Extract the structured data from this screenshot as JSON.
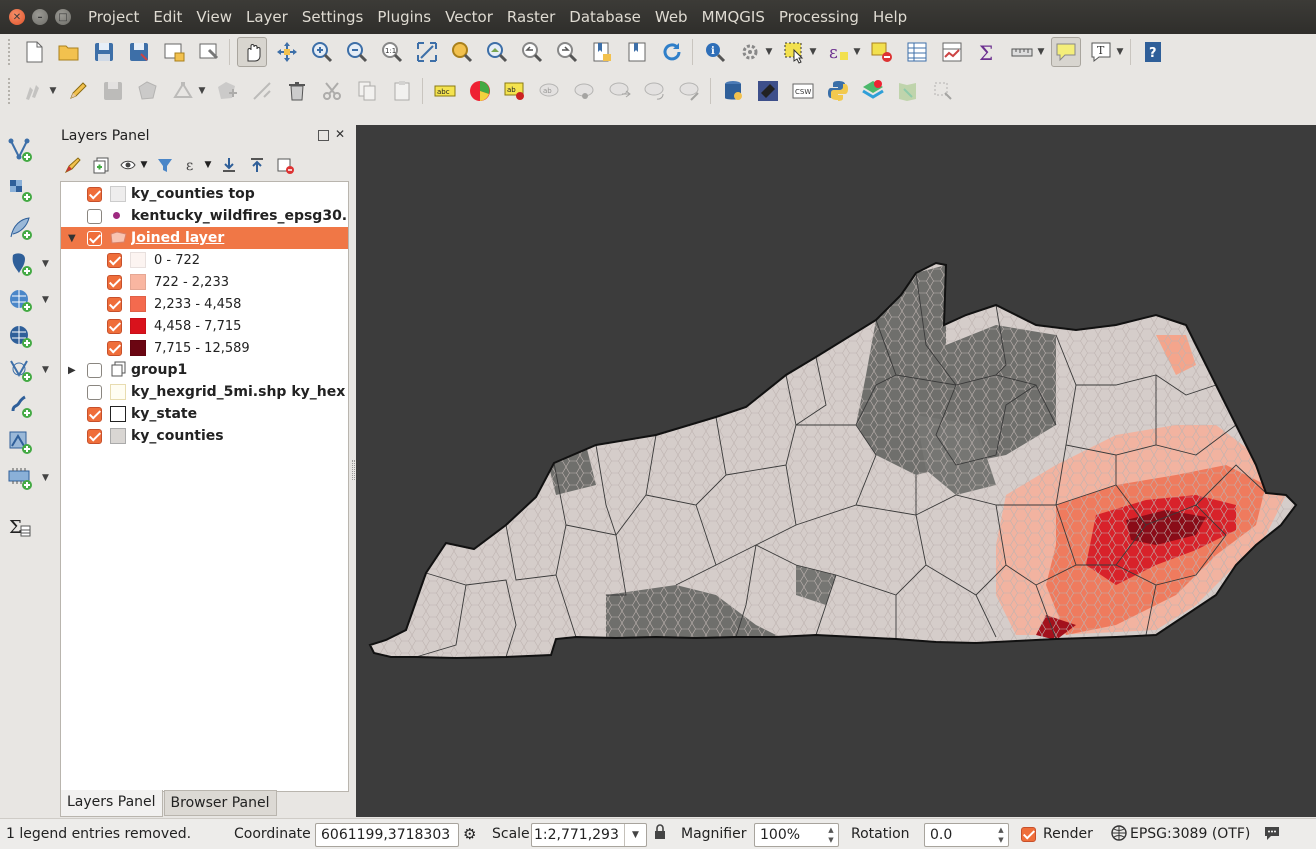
{
  "menubar": {
    "items": [
      "Project",
      "Edit",
      "View",
      "Layer",
      "Settings",
      "Plugins",
      "Vector",
      "Raster",
      "Database",
      "Web",
      "MMQGIS",
      "Processing",
      "Help"
    ]
  },
  "layers_panel": {
    "title": "Layers Panel",
    "layers": [
      {
        "name": "ky_counties top",
        "checked": true
      },
      {
        "name": "kentucky_wildfires_epsg30...",
        "checked": false
      },
      {
        "name": "Joined layer",
        "checked": true,
        "selected": true
      },
      {
        "name": "group1",
        "checked": false
      },
      {
        "name": "ky_hexgrid_5mi.shp ky_hex...",
        "checked": false
      },
      {
        "name": "ky_state",
        "checked": true
      },
      {
        "name": "ky_counties",
        "checked": true
      }
    ],
    "legend": [
      {
        "label": "0 - 722",
        "color": "#fcf4f1"
      },
      {
        "label": "722 - 2,233",
        "color": "#f9b6a1"
      },
      {
        "label": "2,233 - 4,458",
        "color": "#f46a4e"
      },
      {
        "label": "4,458 - 7,715",
        "color": "#d9121c"
      },
      {
        "label": "7,715 - 12,589",
        "color": "#6b0612"
      }
    ],
    "tabs": [
      "Layers Panel",
      "Browser Panel"
    ]
  },
  "statusbar": {
    "message": "1 legend entries removed.",
    "coordinate_label": "Coordinate",
    "coordinate_value": "6061199,3718303",
    "scale_label": "Scale",
    "scale_value": "1:2,771,293",
    "magnifier_label": "Magnifier",
    "magnifier_value": "100%",
    "rotation_label": "Rotation",
    "rotation_value": "0.0",
    "render_label": "Render",
    "crs_label": "EPSG:3089 (OTF)"
  },
  "colors": {
    "map_background": "#3c3c3c",
    "county_fill": "#d5cdca",
    "dark_county_fill": "#6f6f6c",
    "selected_layer": "#f07746"
  }
}
